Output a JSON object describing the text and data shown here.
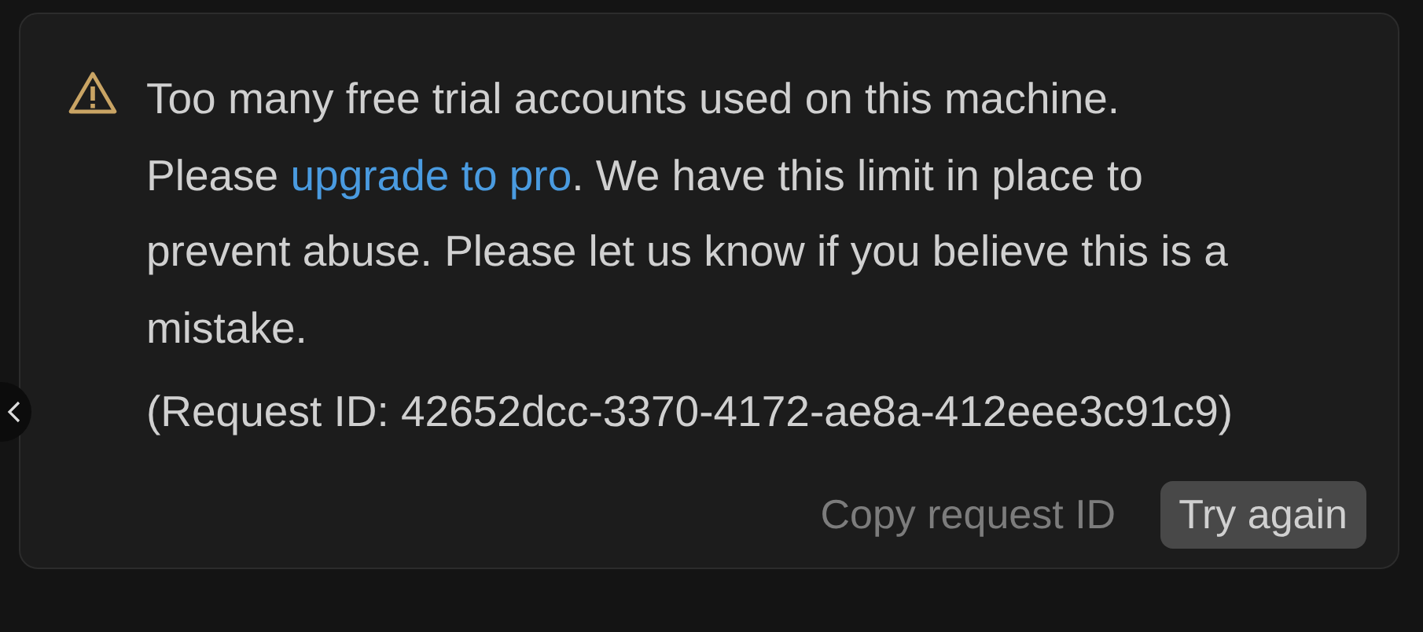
{
  "alert": {
    "message": {
      "before": "Too many free trial accounts used on this machine. Please ",
      "link": "upgrade to pro",
      "after": ". We have this limit in place to prevent abuse. Please let us know if you believe this is a mistake."
    },
    "request_id": "(Request ID: 42652dcc-3370-4172-ae8a-412eee3c91c9)",
    "buttons": [
      {
        "label": "Copy request ID",
        "kind": "text"
      },
      {
        "label": "Try again",
        "kind": "filled"
      }
    ]
  }
}
